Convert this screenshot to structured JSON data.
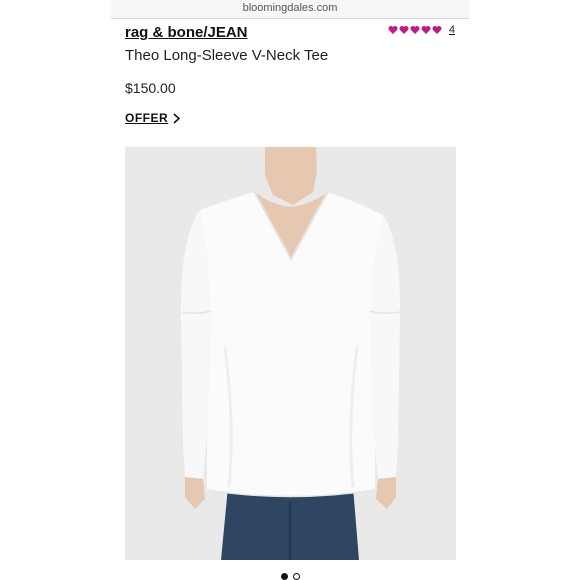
{
  "browser": {
    "url_text": "bloomingdales.com"
  },
  "product": {
    "brand": "rag & bone/JEAN",
    "name": "Theo Long-Sleeve V-Neck Tee",
    "price": "$150.00",
    "offer_label": "OFFER",
    "rating": {
      "value": 5,
      "max": 5,
      "review_count": "4",
      "color": "#c2188c"
    },
    "image": {
      "subject": "white long-sleeve v-neck tee on model",
      "background": "#e9e9e9"
    }
  },
  "carousel": {
    "total": 2,
    "active_index": 0
  },
  "icons": {
    "rating": "heart-icon",
    "offer": "chevron-right-icon"
  }
}
